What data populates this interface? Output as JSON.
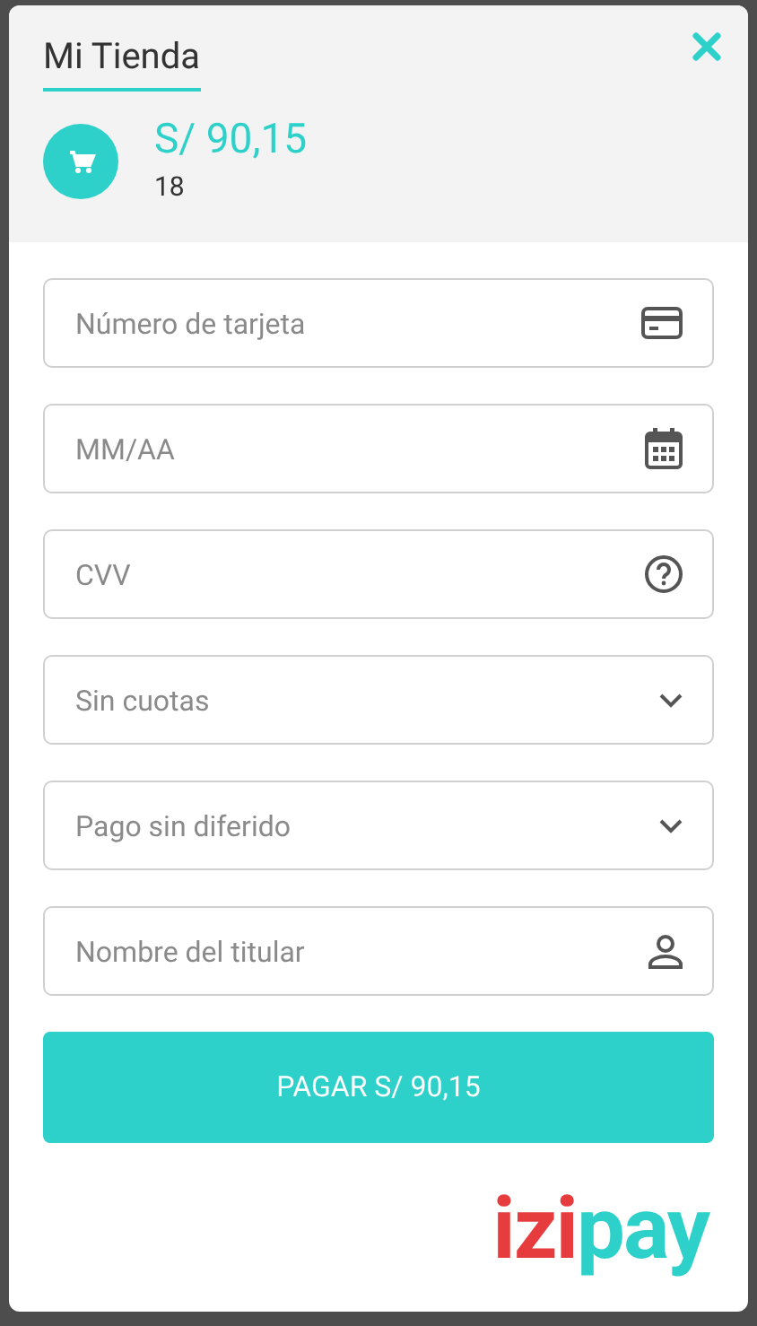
{
  "header": {
    "title": "Mi Tienda",
    "amount": "S/ 90,15",
    "order": "18"
  },
  "fields": [
    {
      "kind": "card",
      "placeholder": "Número de tarjeta"
    },
    {
      "kind": "expiry",
      "placeholder": "MM/AA"
    },
    {
      "kind": "cvv",
      "placeholder": "CVV"
    },
    {
      "kind": "select",
      "placeholder": "Sin cuotas"
    },
    {
      "kind": "select",
      "placeholder": "Pago sin diferido"
    },
    {
      "kind": "holder",
      "placeholder": "Nombre del titular"
    }
  ],
  "pay_button": "PAGAR S/ 90,15",
  "logo": {
    "part_1": "izi",
    "part_2": "pay"
  }
}
